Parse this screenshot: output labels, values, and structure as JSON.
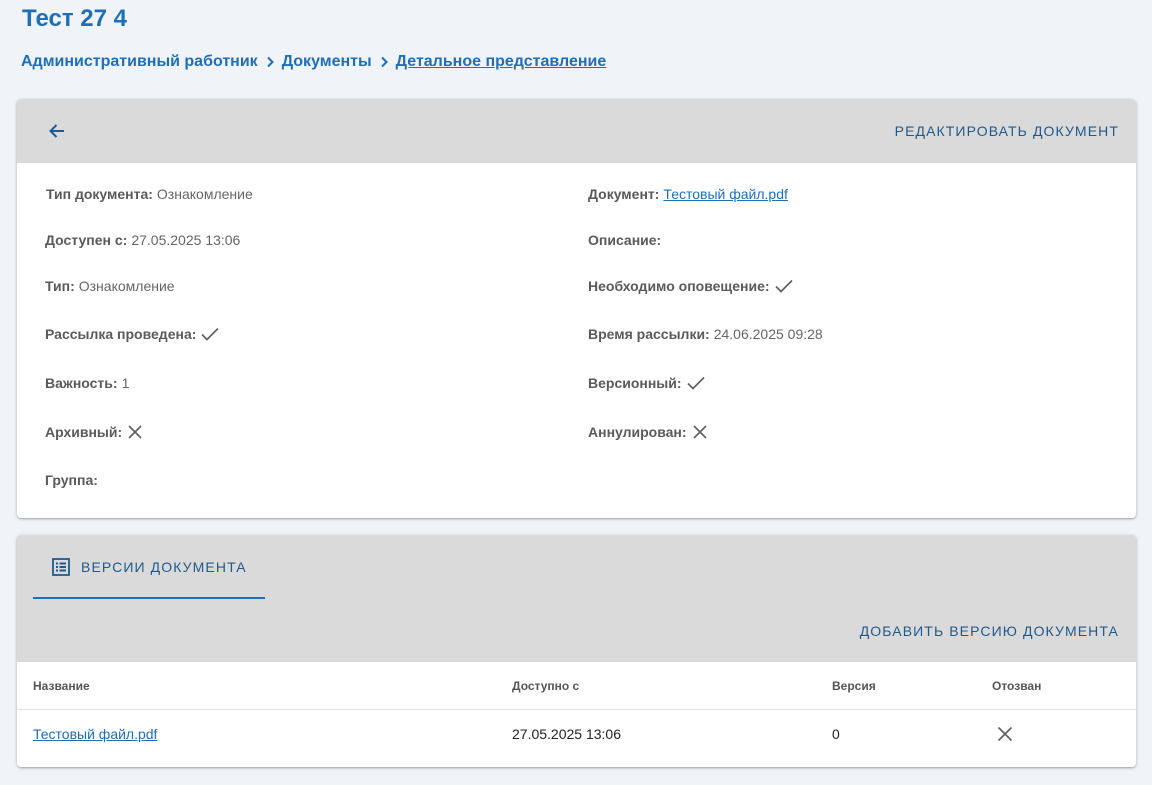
{
  "page_title": "Тест 27 4",
  "breadcrumb": {
    "items": [
      "Административный работник",
      "Документы",
      "Детальное представление"
    ]
  },
  "details": {
    "edit_label": "Редактировать документ",
    "left": {
      "doc_type": {
        "label": "Тип документа:",
        "value": "Ознакомление"
      },
      "available_from": {
        "label": "Доступен с:",
        "value": "27.05.2025 13:06"
      },
      "type": {
        "label": "Тип:",
        "value": "Ознакомление"
      },
      "mailing_done": {
        "label": "Рассылка проведена:",
        "value_icon": "check-icon"
      },
      "importance": {
        "label": "Важность:",
        "value": "1"
      },
      "archived": {
        "label": "Архивный:",
        "value_icon": "close-icon"
      },
      "group": {
        "label": "Группа:",
        "value": ""
      }
    },
    "right": {
      "document": {
        "label": "Документ:",
        "value": "Тестовый файл.pdf"
      },
      "description": {
        "label": "Описание:",
        "value": ""
      },
      "notification_required": {
        "label": "Необходимо оповещение:",
        "value_icon": "check-icon"
      },
      "mailing_time": {
        "label": "Время рассылки:",
        "value": "24.06.2025 09:28"
      },
      "versioned": {
        "label": "Версионный:",
        "value_icon": "check-icon"
      },
      "annulled": {
        "label": "Аннулирован:",
        "value_icon": "close-icon"
      }
    }
  },
  "versions": {
    "tab_label": "Версии документа",
    "tab_icon": "list-icon",
    "add_label": "Добавить версию документа",
    "columns": [
      "Название",
      "Доступно с",
      "Версия",
      "Отозван"
    ],
    "rows": [
      {
        "name": "Тестовый файл.pdf",
        "available_from": "27.05.2025 13:06",
        "version": "0",
        "revoked_icon": "close-icon"
      }
    ]
  },
  "colors": {
    "accent": "#1e6fb8",
    "header_bg": "#dadada",
    "page_bg": "#f0f3f7"
  }
}
